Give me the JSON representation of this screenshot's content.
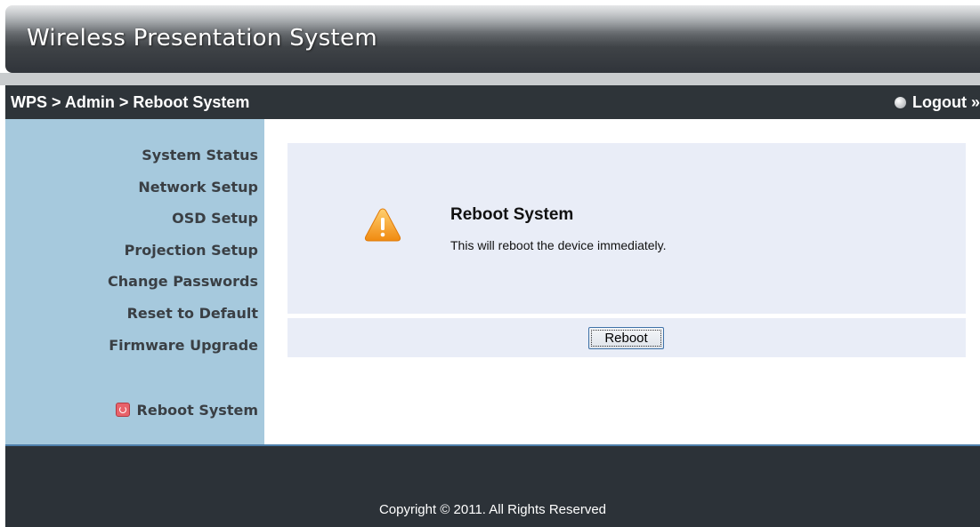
{
  "app": {
    "title": "Wireless Presentation System"
  },
  "nav": {
    "breadcrumb": "WPS > Admin > Reboot System",
    "logout": "Logout »"
  },
  "sidebar": {
    "items": [
      {
        "label": "System Status"
      },
      {
        "label": "Network Setup"
      },
      {
        "label": "OSD Setup"
      },
      {
        "label": "Projection Setup"
      },
      {
        "label": "Change Passwords"
      },
      {
        "label": "Reset to Default"
      },
      {
        "label": "Firmware Upgrade"
      },
      {
        "label": "Reboot System",
        "icon": "power-icon",
        "active": true
      }
    ]
  },
  "main": {
    "icon": "warning-icon",
    "title": "Reboot System",
    "description": "This will reboot the device immediately.",
    "button_label": "Reboot"
  },
  "footer": {
    "copyright": "Copyright © 2011. All Rights Reserved"
  },
  "colors": {
    "header_bg": "#3f4347",
    "navbar_bg": "#2e3439",
    "sidebar_bg": "#a6c9dd",
    "panel_bg": "#e9edf7",
    "footer_bg": "#2c3238",
    "warning": "#f39b1c",
    "power_icon": "#e8626a"
  }
}
